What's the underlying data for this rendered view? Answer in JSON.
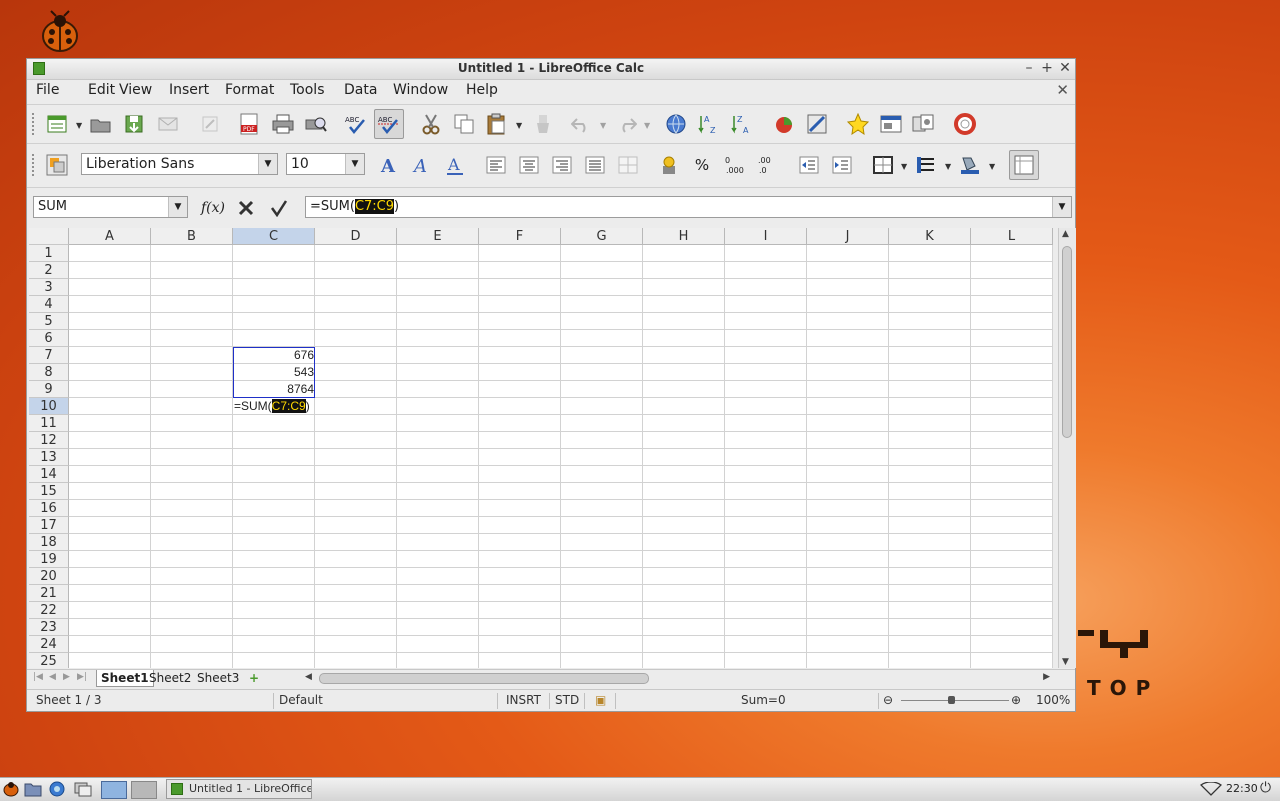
{
  "window": {
    "title": "Untitled 1 - LibreOffice Calc"
  },
  "menu": [
    "File",
    "Edit",
    "View",
    "Insert",
    "Format",
    "Tools",
    "Data",
    "Window",
    "Help"
  ],
  "font": {
    "name": "Liberation Sans",
    "size": "10"
  },
  "namebox": "SUM",
  "formula": {
    "prefix": "=SUM(",
    "ref": "C7:C9",
    "suffix": ")"
  },
  "columns": [
    "A",
    "B",
    "C",
    "D",
    "E",
    "F",
    "G",
    "H",
    "I",
    "J",
    "K",
    "L"
  ],
  "rows": [
    "1",
    "2",
    "3",
    "4",
    "5",
    "6",
    "7",
    "8",
    "9",
    "10",
    "11",
    "12",
    "13",
    "14",
    "15",
    "16",
    "17",
    "18",
    "19",
    "20",
    "21",
    "22",
    "23",
    "24",
    "25"
  ],
  "cells": {
    "c7": "676",
    "c8": "543",
    "c9": "8764"
  },
  "sheets": [
    "Sheet1",
    "Sheet2",
    "Sheet3"
  ],
  "status": {
    "sheet": "Sheet 1 / 3",
    "style": "Default",
    "insert_mode": "INSRT",
    "selection_mode": "STD",
    "sum": "Sum=0",
    "zoom": "100%"
  },
  "taskbar": {
    "task_label": "Untitled 1 - LibreOffice ...",
    "time": "22:30"
  },
  "desktop": {
    "logo_text": "TOP"
  },
  "colors": {
    "accent_selection": "#1f30c8",
    "header_selected": "#c4d4ea",
    "formula_highlight_bg": "#111111",
    "formula_highlight_fg": "#ffd800"
  }
}
